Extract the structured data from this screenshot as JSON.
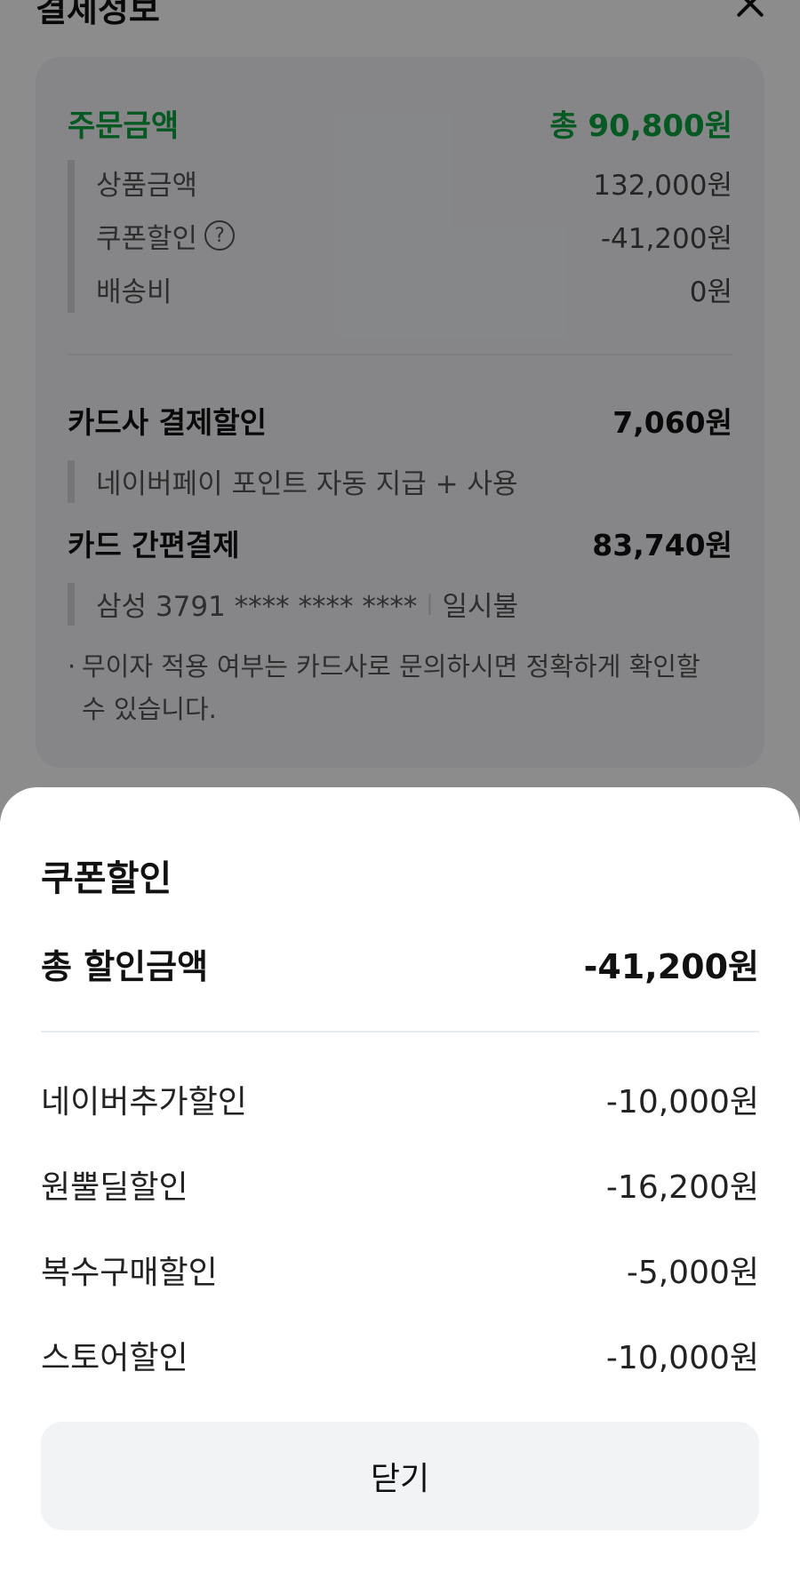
{
  "background": {
    "title": "결제정보",
    "order": {
      "label": "주문금액",
      "value": "총 90,800원"
    },
    "details": [
      {
        "label": "상품금액",
        "value": "132,000원"
      },
      {
        "label": "쿠폰할인",
        "value": "-41,200원",
        "has_help": true
      },
      {
        "label": "배송비",
        "value": "0원"
      }
    ],
    "help_icon": "?",
    "card_discount": {
      "label": "카드사 결제할인",
      "value": "7,060원",
      "sub": "네이버페이 포인트 자동 지급 + 사용"
    },
    "card_payment": {
      "label": "카드 간편결제",
      "value": "83,740원",
      "card": "삼성 3791 **** **** ****",
      "installment": "일시불"
    },
    "note": "무이자 적용 여부는 카드사로 문의하시면 정확하게 확인할 수 있습니다."
  },
  "sheet": {
    "title": "쿠폰할인",
    "total": {
      "label": "총 할인금액",
      "value": "-41,200원"
    },
    "items": [
      {
        "label": "네이버추가할인",
        "value": "-10,000원"
      },
      {
        "label": "원뿔딜할인",
        "value": "-16,200원"
      },
      {
        "label": "복수구매할인",
        "value": "-5,000원"
      },
      {
        "label": "스토어할인",
        "value": "-10,000원"
      }
    ],
    "close_label": "닫기"
  }
}
